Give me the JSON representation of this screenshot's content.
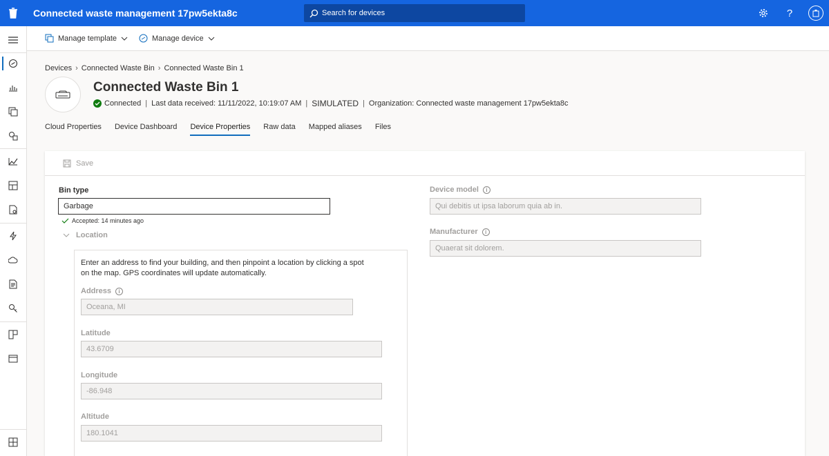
{
  "app": {
    "title": "Connected waste management 17pw5ekta8c"
  },
  "search": {
    "placeholder": "Search for devices"
  },
  "commands": {
    "manage_template": "Manage template",
    "manage_device": "Manage device"
  },
  "breadcrumb": {
    "devices": "Devices",
    "template": "Connected Waste Bin",
    "current": "Connected Waste Bin 1"
  },
  "device": {
    "title": "Connected Waste Bin 1",
    "status": "Connected",
    "last_data": "Last data received: 11/11/2022, 10:19:07 AM",
    "simulated": "SIMULATED",
    "organization": "Organization: Connected waste management 17pw5ekta8c"
  },
  "tabs": [
    "Cloud Properties",
    "Device Dashboard",
    "Device Properties",
    "Raw data",
    "Mapped aliases",
    "Files"
  ],
  "active_tab": "Device Properties",
  "toolbar": {
    "save_label": "Save"
  },
  "form": {
    "bin_type": {
      "label": "Bin type",
      "value": "Garbage",
      "accepted": "Accepted: 14 minutes ago"
    },
    "location": {
      "label": "Location",
      "description": "Enter an address to find your building, and then pinpoint a location by clicking a spot on the map. GPS coordinates will update automatically.",
      "address": {
        "label": "Address",
        "value": "Oceana, MI"
      },
      "latitude": {
        "label": "Latitude",
        "value": "43.6709"
      },
      "longitude": {
        "label": "Longitude",
        "value": "-86.948"
      },
      "altitude": {
        "label": "Altitude",
        "value": "180.1041"
      }
    },
    "device_model": {
      "label": "Device model",
      "value": "Qui debitis ut ipsa laborum quia ab in."
    },
    "manufacturer": {
      "label": "Manufacturer",
      "value": "Quaerat sit dolorem."
    }
  },
  "colors": {
    "header": "#1565e0",
    "accent": "#0f6cbd",
    "success": "#107c10"
  }
}
